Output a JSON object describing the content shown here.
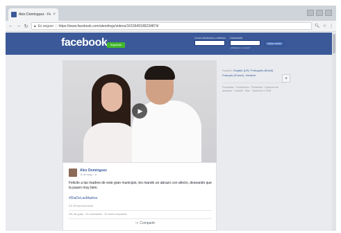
{
  "browser": {
    "tab_title": "Alex Domínguez - Felicito a...",
    "tab_close": "×",
    "address_secure": "Es seguro",
    "address_url": "https://www.facebook.com/alexdmgz/videos/1015649186234874/"
  },
  "facebook": {
    "logo": "facebook",
    "register_button": "Regístrate",
    "login": {
      "email_label": "Correo electrónico o teléfono",
      "password_label": "Contraseña",
      "forgot_link": "¿Olvidaste tu cuenta?",
      "login_button": "Iniciar sesión"
    }
  },
  "sidebar": {
    "languages": [
      "Español",
      "English (US)",
      "Português (Brasil)",
      "Français (France)",
      "Deutsch"
    ],
    "footer": "Privacidad · Condiciones · Publicidad · Opciones de anuncios · Cookies · Más · Facebook © 2018"
  },
  "post": {
    "author": "Alex Domínguez",
    "date": "10 de mayo · ",
    "text": "Felicito a las madres de este gran municipio, les mando un abrazo con afecto, deseando que la pasen muy bien.",
    "hashtag": "#DiaDeLasMadres",
    "views": "5,8 mil reproducciones",
    "stats": "391 Me gusta · 22 comentarios · 39 veces compartido",
    "share_label": "Compartir"
  }
}
